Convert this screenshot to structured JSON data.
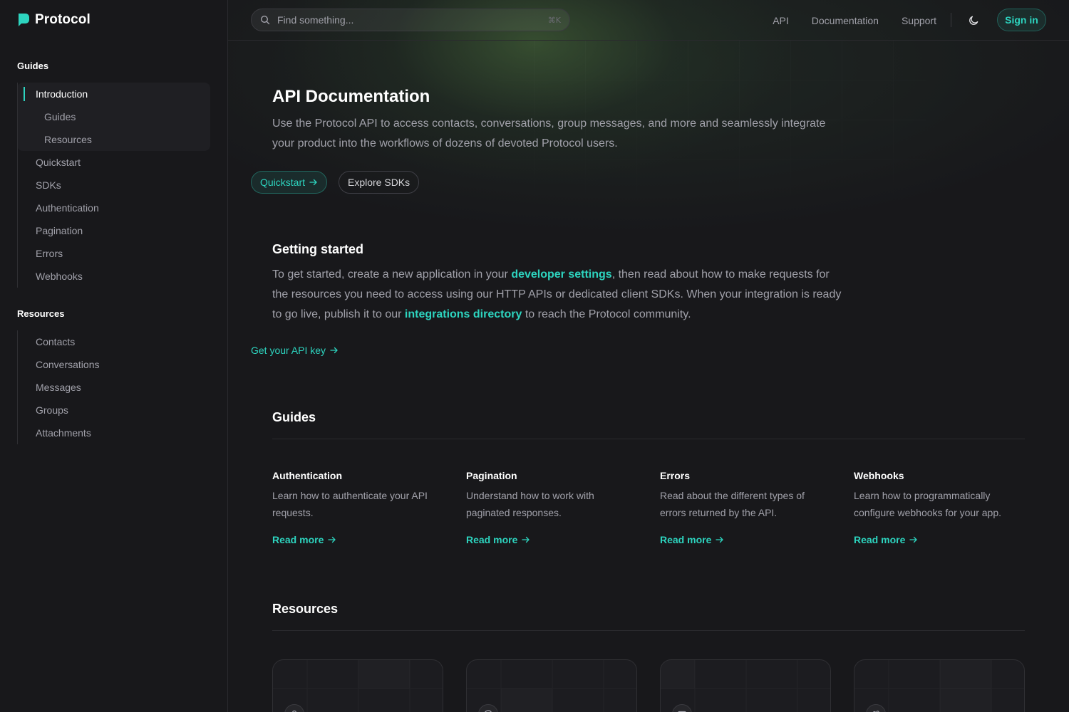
{
  "app": {
    "name": "Protocol"
  },
  "sidebar": {
    "guides_title": "Guides",
    "guides": [
      {
        "label": "Introduction",
        "active": true
      },
      {
        "label": "Guides",
        "sub": true
      },
      {
        "label": "Resources",
        "sub": true
      },
      {
        "label": "Quickstart"
      },
      {
        "label": "SDKs"
      },
      {
        "label": "Authentication"
      },
      {
        "label": "Pagination"
      },
      {
        "label": "Errors"
      },
      {
        "label": "Webhooks"
      }
    ],
    "resources_title": "Resources",
    "resources": [
      {
        "label": "Contacts"
      },
      {
        "label": "Conversations"
      },
      {
        "label": "Messages"
      },
      {
        "label": "Groups"
      },
      {
        "label": "Attachments"
      }
    ]
  },
  "header": {
    "search_placeholder": "Find something...",
    "search_shortcut": "⌘K",
    "links": [
      "API",
      "Documentation",
      "Support"
    ],
    "theme_icon": "moon-icon",
    "signin": "Sign in"
  },
  "hero": {
    "title": "API Documentation",
    "lead": "Use the Protocol API to access contacts, conversations, group messages, and more and seamlessly integrate your product into the workflows of dozens of devoted Protocol users.",
    "primary_button": "Quickstart",
    "secondary_button": "Explore SDKs"
  },
  "getting_started": {
    "title": "Getting started",
    "text_1": "To get started, create a new application in your ",
    "link_1": "developer settings",
    "text_2": ", then read about how to make requests for the resources you need to access using our HTTP APIs or dedicated client SDKs. When your integration is ready to go live, publish it to our ",
    "link_2": "integrations directory",
    "text_3": " to reach the Protocol community.",
    "cta": "Get your API key"
  },
  "guides_section": {
    "title": "Guides",
    "cards": [
      {
        "title": "Authentication",
        "desc": "Learn how to authenticate your API requests.",
        "link": "Read more"
      },
      {
        "title": "Pagination",
        "desc": "Understand how to work with paginated responses.",
        "link": "Read more"
      },
      {
        "title": "Errors",
        "desc": "Read about the different types of errors returned by the API.",
        "link": "Read more"
      },
      {
        "title": "Webhooks",
        "desc": "Learn how to programmatically configure webhooks for your app.",
        "link": "Read more"
      }
    ]
  },
  "resources_section": {
    "title": "Resources",
    "cards": [
      {
        "icon": "user-icon"
      },
      {
        "icon": "chat-bubble-icon"
      },
      {
        "icon": "envelope-icon"
      },
      {
        "icon": "users-icon"
      }
    ]
  },
  "colors": {
    "accent": "#2dd4bf",
    "background": "#18181b"
  }
}
